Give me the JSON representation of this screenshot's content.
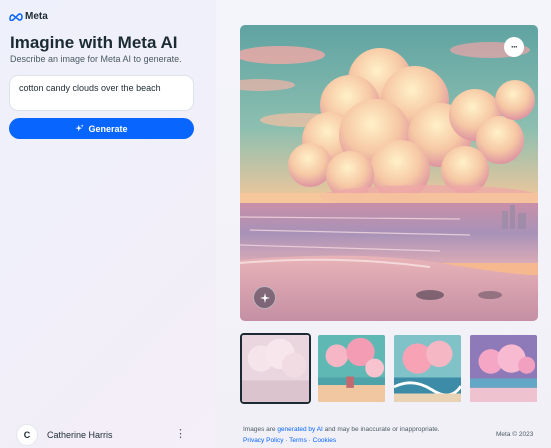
{
  "brand": {
    "logo_text": "Meta",
    "logo_icon": "meta-infinity-icon",
    "accent": "#0866ff"
  },
  "header": {
    "title": "Imagine with Meta AI",
    "subtitle": "Describe an image for Meta AI to generate."
  },
  "prompt": {
    "value": "cotton candy clouds over the beach"
  },
  "generate": {
    "label": "Generate",
    "icon": "sparkle-icon"
  },
  "user": {
    "initial": "C",
    "name": "Catherine Harris",
    "menu_icon": "more-vertical-icon"
  },
  "image": {
    "alt": "cotton candy clouds over the beach",
    "menu_label": "···",
    "badge_icon": "ai-sparkle-badge-icon"
  },
  "thumbnails": [
    {
      "name": "thumbnail-1",
      "selected": true
    },
    {
      "name": "thumbnail-2",
      "selected": false
    },
    {
      "name": "thumbnail-3",
      "selected": false
    },
    {
      "name": "thumbnail-4",
      "selected": false
    }
  ],
  "footer": {
    "note_prefix": "Images are ",
    "note_link": "generated by AI",
    "note_suffix": " and may be inaccurate or inappropriate.",
    "privacy": "Privacy Policy",
    "sep1": " · ",
    "terms": "Terms",
    "sep2": " · ",
    "cookies": "Cookies",
    "copyright": "Meta © 2023"
  }
}
